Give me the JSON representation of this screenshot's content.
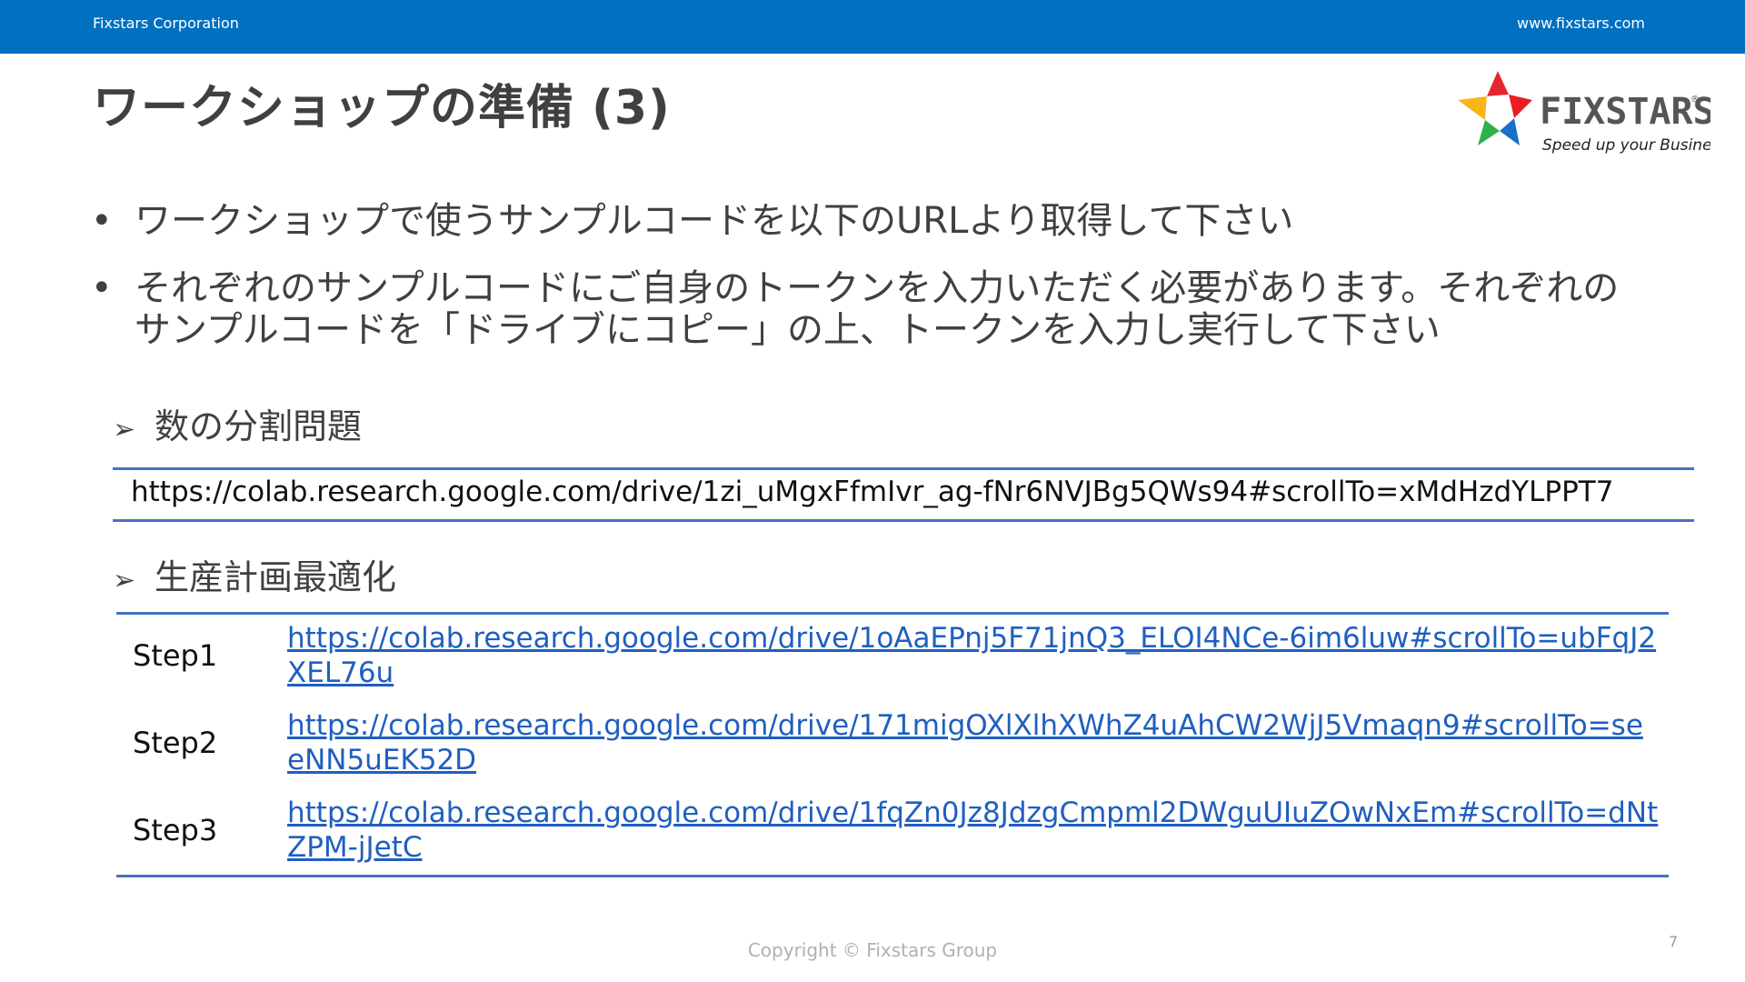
{
  "header": {
    "company": "Fixstars Corporation",
    "website": "www.fixstars.com"
  },
  "title": "ワークショップの準備 (3)",
  "logo": {
    "name": "FIXSTARS",
    "tagline": "Speed up your Business",
    "registered": "®"
  },
  "bullets": [
    "ワークショップで使うサンプルコードを以下のURLより取得して下さい",
    "それぞれのサンプルコードにご自身のトークンを入力いただく必要があります。それぞれのサンプルコードを「ドライブにコピー」の上、トークンを入力し実行して下さい"
  ],
  "bullet_marker": "•",
  "sub_marker": "➢",
  "sections": {
    "partition": {
      "heading": "数の分割問題",
      "url": "https://colab.research.google.com/drive/1zi_uMgxFfmIvr_ag-fNr6NVJBg5QWs94#scrollTo=xMdHzdYLPPT7"
    },
    "production": {
      "heading": "生産計画最適化",
      "steps": [
        {
          "label": "Step1",
          "url": "https://colab.research.google.com/drive/1oAaEPnj5F71jnQ3_ELOI4NCe-6im6luw#scrollTo=ubFqJ2XEL76u"
        },
        {
          "label": "Step2",
          "url": "https://colab.research.google.com/drive/171migOXlXlhXWhZ4uAhCW2WjJ5Vmaqn9#scrollTo=seeNN5uEK52D"
        },
        {
          "label": "Step3",
          "url": "https://colab.research.google.com/drive/1fqZn0Jz8JdzgCmpml2DWguUIuZOwNxEm#scrollTo=dNtZPM-jJetC"
        }
      ]
    }
  },
  "footer": {
    "copyright": "Copyright © Fixstars Group",
    "page": "7"
  },
  "colors": {
    "topbar": "#0070c0",
    "rule": "#4472c4",
    "link": "#1f5fbf"
  }
}
